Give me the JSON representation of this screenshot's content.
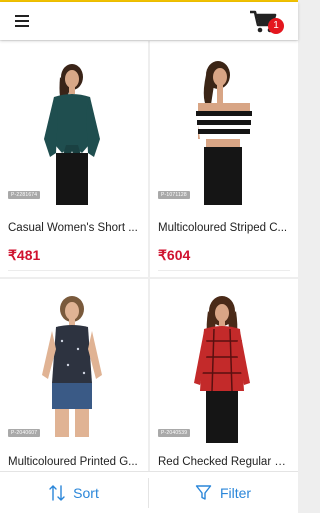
{
  "header": {
    "menu_icon": "hamburger-menu-icon",
    "cart_icon": "shopping-cart-icon",
    "cart_count": "1"
  },
  "products": [
    {
      "title": "Casual Women's Short ...",
      "price": "₹481",
      "code": "P-2281674"
    },
    {
      "title": "Multicoloured Striped C...",
      "price": "₹604",
      "code": "P-1071128"
    },
    {
      "title": "Multicoloured Printed G...",
      "price": "",
      "code": "P-2040607"
    },
    {
      "title": "Red Checked Regular Fi...",
      "price": "",
      "code": "P-2040539"
    }
  ],
  "bottom_bar": {
    "sort_label": "Sort",
    "filter_label": "Filter",
    "sort_icon": "sort-arrows-icon",
    "filter_icon": "funnel-filter-icon"
  },
  "colors": {
    "accent": "#2a86d9",
    "price": "#d0122f",
    "badge": "#e4161e",
    "top_line": "#f2c200"
  }
}
